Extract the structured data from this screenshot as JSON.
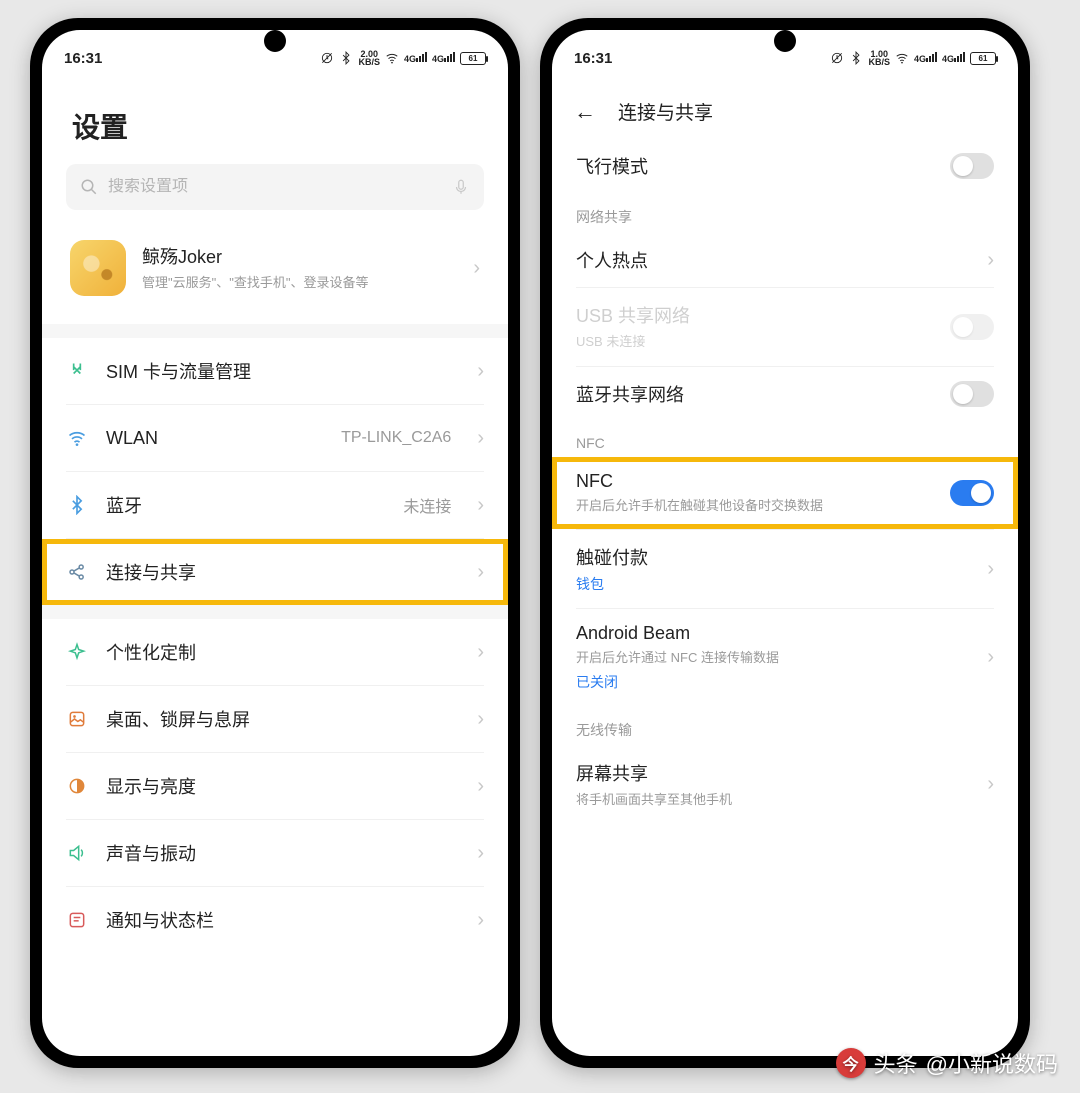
{
  "status": {
    "time": "16:31",
    "net_speed_left": "2.00",
    "net_speed_right": "1.00",
    "net_unit": "KB/S",
    "sig_label": "4G",
    "battery": "61"
  },
  "screen1": {
    "title": "设置",
    "search_placeholder": "搜索设置项",
    "account": {
      "name": "鲸殇Joker",
      "sub": "管理\"云服务\"、\"查找手机\"、登录设备等"
    },
    "rows": [
      {
        "icon": "sim-icon",
        "label": "SIM 卡与流量管理",
        "value": "",
        "highlighted": false
      },
      {
        "icon": "wifi-icon",
        "label": "WLAN",
        "value": "TP-LINK_C2A6",
        "highlighted": false
      },
      {
        "icon": "bluetooth-icon",
        "label": "蓝牙",
        "value": "未连接",
        "highlighted": false
      },
      {
        "icon": "share-icon",
        "label": "连接与共享",
        "value": "",
        "highlighted": true
      }
    ],
    "rows2": [
      {
        "icon": "palette-icon",
        "label": "个性化定制"
      },
      {
        "icon": "desktop-icon",
        "label": "桌面、锁屏与息屏"
      },
      {
        "icon": "display-icon",
        "label": "显示与亮度"
      },
      {
        "icon": "sound-icon",
        "label": "声音与振动"
      },
      {
        "icon": "notify-icon",
        "label": "通知与状态栏"
      }
    ]
  },
  "screen2": {
    "header": "连接与共享",
    "airplane": {
      "label": "飞行模式",
      "on": false
    },
    "section_net": "网络共享",
    "hotspot": {
      "label": "个人热点"
    },
    "usb": {
      "label": "USB 共享网络",
      "sub": "USB 未连接",
      "on": false,
      "disabled": true
    },
    "bt_tether": {
      "label": "蓝牙共享网络",
      "on": false
    },
    "section_nfc": "NFC",
    "nfc": {
      "label": "NFC",
      "sub": "开启后允许手机在触碰其他设备时交换数据",
      "on": true,
      "highlighted": true
    },
    "touch_pay": {
      "label": "触碰付款",
      "link": "钱包"
    },
    "beam": {
      "label": "Android Beam",
      "sub": "开启后允许通过 NFC 连接传输数据",
      "status": "已关闭"
    },
    "section_wireless": "无线传输",
    "screen_share": {
      "label": "屏幕共享",
      "sub": "将手机画面共享至其他手机"
    }
  },
  "watermark": {
    "prefix": "头条",
    "author": "@小新说数码"
  }
}
